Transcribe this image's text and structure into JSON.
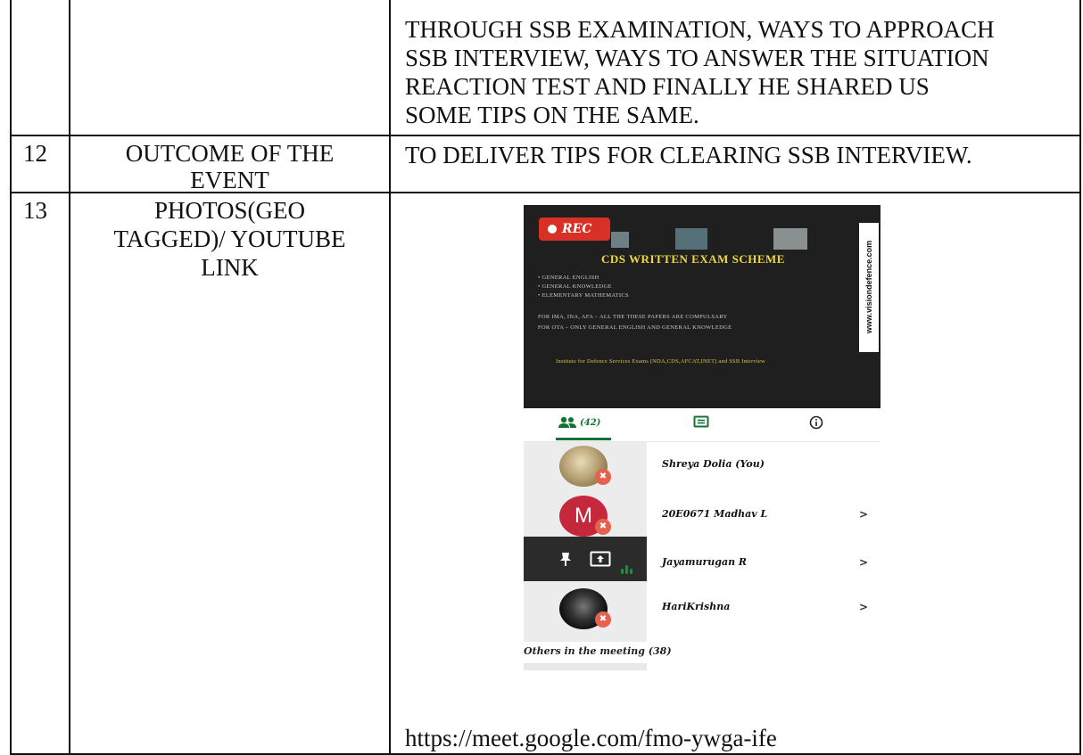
{
  "rows": [
    {
      "num": "",
      "label": "",
      "content_lines": [
        "THROUGH SSB EXAMINATION, WAYS TO APPROACH",
        "SSB INTERVIEW, WAYS TO ANSWER THE SITUATION",
        "REACTION TEST AND FINALLY HE SHARED US",
        "SOME TIPS ON THE SAME."
      ]
    },
    {
      "num": "12",
      "label_lines": [
        "OUTCOME OF THE",
        "EVENT"
      ],
      "content": "TO DELIVER TIPS FOR CLEARING SSB INTERVIEW."
    },
    {
      "num": "13",
      "label_lines": [
        "PHOTOS(GEO",
        "TAGGED)/ YOUTUBE",
        "LINK"
      ],
      "link": "https://meet.google.com/fmo-ywga-ife"
    }
  ],
  "screenshot": {
    "rec_label": "REC",
    "slide": {
      "title": "CDS WRITTEN EXAM SCHEME",
      "lines": [
        "• GENERAL ENGLISH",
        "• GENERAL KNOWLEDGE",
        "• ELEMENTARY MATHEMATICS",
        "FOR IMA, INA, AFA – ALL THE THESE PAPERS ARE COMPULSARY",
        "FOR OTA – ONLY GENERAL ENGLISH AND GENERAL KNOWLEDGE"
      ],
      "institute": "Institute for Defence Services Exams (NDA,CDS,AFCAT,INET) and SSB Interview",
      "website": "www.visiondefence.com"
    },
    "tabs": {
      "people_count": "(42)"
    },
    "participants": [
      {
        "name": "Shreya Dolia (You)",
        "avatar": "photo",
        "muted": true,
        "chevron": ""
      },
      {
        "name": "20E0671 Madhav L",
        "avatar_letter": "M",
        "muted": true,
        "chevron": ">"
      },
      {
        "name": "Jayamurugan R",
        "avatar": "presenting",
        "muted": false,
        "chevron": ">"
      },
      {
        "name": "HariKrishna",
        "avatar": "photo-dark",
        "muted": true,
        "chevron": ">"
      }
    ],
    "others_label": "Others in the meeting (38)",
    "colors": {
      "rec": "#d93025",
      "accent_green": "#137333",
      "avatar_m": "#c5283d",
      "mic_off": "#e8614f",
      "slide_title": "#f0d83a"
    }
  }
}
